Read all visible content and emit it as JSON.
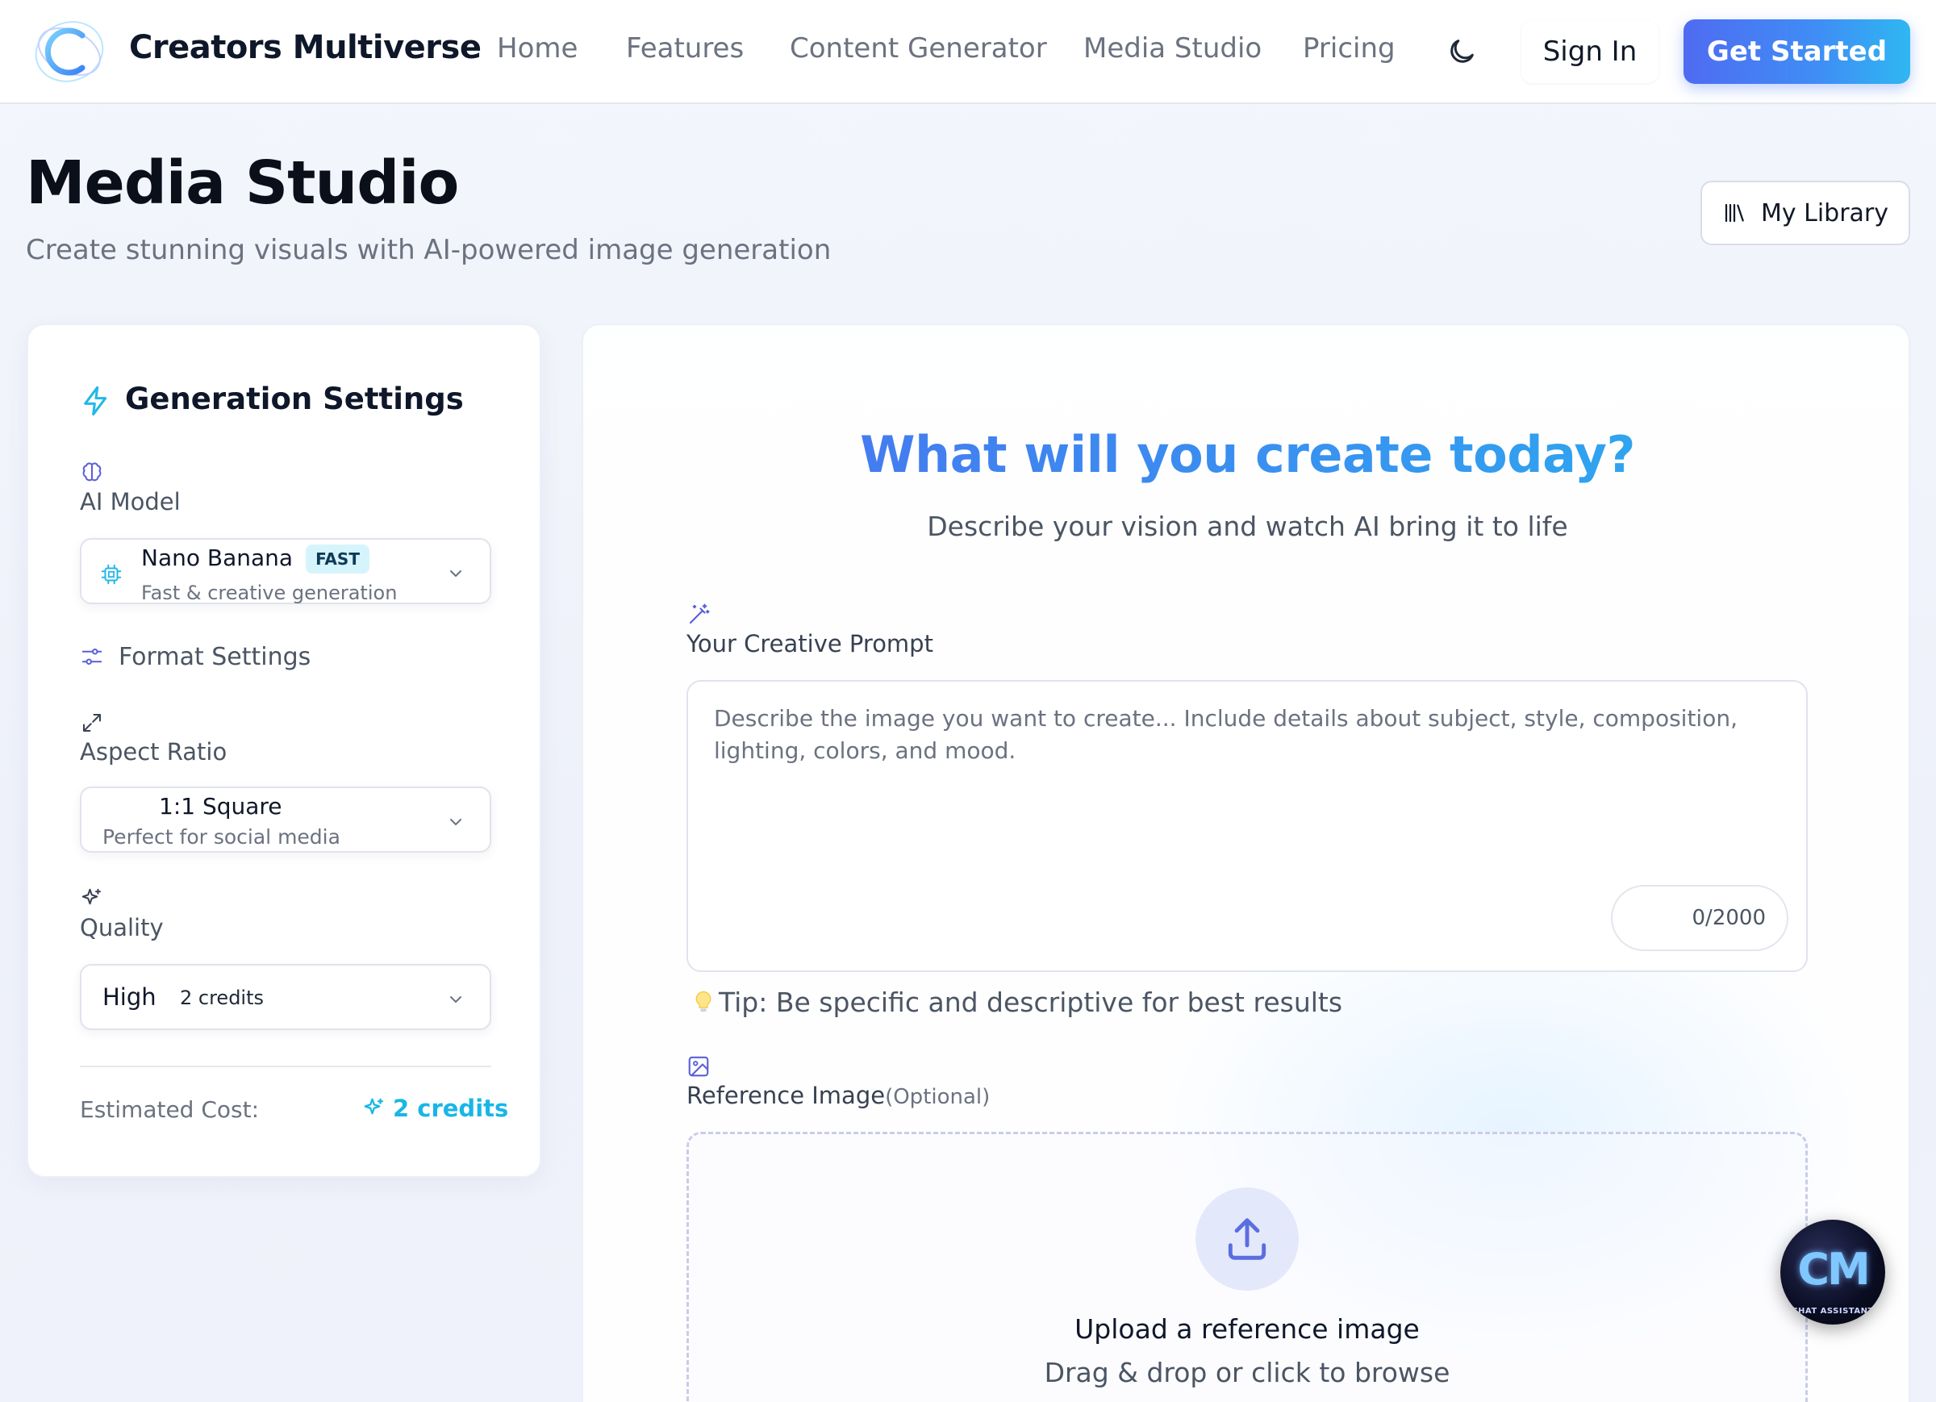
{
  "nav": {
    "brand": "Creators Multiverse",
    "links": [
      "Home",
      "Features",
      "Content Generator",
      "Media Studio",
      "Pricing"
    ],
    "sign_in": "Sign In",
    "get_started": "Get Started"
  },
  "header": {
    "title": "Media Studio",
    "subtitle": "Create stunning visuals with AI-powered image generation",
    "library_button": "My Library"
  },
  "settings": {
    "title": "Generation Settings",
    "ai_model_label": "AI Model",
    "model": {
      "name": "Nano Banana",
      "badge": "FAST",
      "description": "Fast & creative generation"
    },
    "format_label": "Format Settings",
    "aspect_ratio_label": "Aspect Ratio",
    "aspect_ratio": {
      "value": "1:1 Square",
      "description": "Perfect for social media"
    },
    "quality_label": "Quality",
    "quality": {
      "value": "High",
      "credits": "2 credits"
    },
    "cost_label": "Estimated Cost:",
    "cost_value": "2 credits"
  },
  "main": {
    "hero_title": "What will you create today?",
    "hero_subtitle": "Describe your vision and watch AI bring it to life",
    "prompt_label": "Your Creative Prompt",
    "prompt_placeholder": "Describe the image you want to create... Include details about subject, style, composition, lighting, colors, and mood.",
    "char_count": "0/2000",
    "tip": "Tip: Be specific and descriptive for best results",
    "reference_label": "Reference Image",
    "reference_optional": "(Optional)",
    "upload_title": "Upload a reference image",
    "upload_subtitle": "Drag & drop or click to browse"
  },
  "chat": {
    "logo_text": "CM",
    "caption": "CHAT ASSISTANT"
  },
  "colors": {
    "accent_blue": "#4f6bf2",
    "accent_cyan": "#2fb7f2",
    "credits_cyan": "#18b6e6"
  }
}
